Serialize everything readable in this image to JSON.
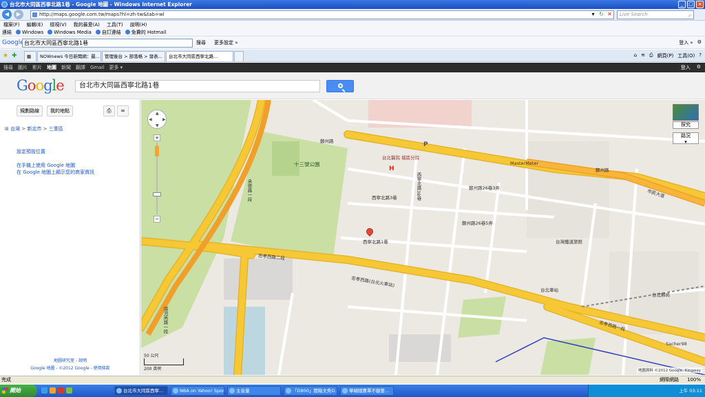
{
  "browser": {
    "title": "台北市大同區西寧北路1巷 - Google 地圖 - Windows Internet Explorer",
    "address": "http://maps.google.com.tw/maps?hl=zh-tw&tab=wl",
    "live_search": "Live Search",
    "menu": [
      "檔案(F)",
      "編輯(E)",
      "檢視(V)",
      "我的最愛(A)",
      "工具(T)",
      "說明(H)"
    ],
    "links": [
      "連結",
      "Windows",
      "Windows Media",
      "自訂連結",
      "免費的 Hotmail"
    ],
    "gtoolbar_label": "Google",
    "gtoolbar_query": "台北市大同區西寧北路1巷",
    "gtoolbar_search": "搜尋",
    "gtoolbar_more": "更多設定 »",
    "gtoolbar_login": "登入 »",
    "tabs": [
      "NOWnews 今日新聞網：最...",
      "管理後台 > 部落格 > 發表...",
      "台北市大同區西寧北路..."
    ],
    "cmd": [
      "網頁(P)",
      "工具(O)"
    ]
  },
  "gbar": {
    "items": [
      "搜尋",
      "圖片",
      "影片",
      "地圖",
      "新聞",
      "翻譯",
      "Gmail",
      "更多 ▾"
    ],
    "login": "登入"
  },
  "search": {
    "logo": "Google",
    "query": "台北市大同區西寧北路1巷"
  },
  "panel": {
    "directions": "規劃路線",
    "my_places": "我的地點",
    "breadcrumb": [
      "台灣",
      "新北市",
      "三重區"
    ],
    "set_default": "設定預設位置",
    "mobile": "在手機上使用 Google 地圖",
    "report": "在 Google 地圖上顯示您的商家資訊",
    "footer_help": "地圖研究室 - 說明",
    "footer_copy": "Google 地圖 - ©2012 Google - 使用條款"
  },
  "map": {
    "labels": {
      "park": "十三號公園",
      "hospital": "台北醫院\n城區分院",
      "zhengzhou1": "鄭州路",
      "zhengzhou2": "鄭州路",
      "civic": "市民大道",
      "zhongxiao1": "忠孝西路二段",
      "zhongxiao2": "忠孝西路(台北火車站)",
      "zhongxiao3": "忠孝西路一段",
      "xining": "西寧北路1巷",
      "xining3": "西寧北路3巷",
      "lane38": "西寧北路38巷",
      "zhengzhou26_3": "鄭州路26巷3弄",
      "zhengzhou26_5": "鄭州路26巷5弄",
      "chengde": "承德路一段",
      "huaining": "環河南路一段",
      "taipei_station": "台北車站",
      "inn": "台灣鐵道旅館",
      "post": "台北郵局",
      "sacher": "Sacher98",
      "mastermeter": "MasterMeter",
      "p": "P"
    },
    "maptype": "探究",
    "traffic": "路況",
    "scale_top": "50 公尺",
    "scale_bottom": "200 英呎",
    "logo": "Google",
    "copyright": "地圖資料 ©2012 Google, Kingway"
  },
  "status": {
    "left": "完成",
    "zone": "網際網路",
    "zoom": "100%"
  },
  "taskbar": {
    "start": "開始",
    "buttons": [
      "台北市大同區西寧...",
      "NBA on Yahoo! Sport...",
      "主音量",
      "「D800」開箱文秀D...",
      "華碩隨賣單不額筆..."
    ],
    "clock": "上午 03:11"
  },
  "colors": {
    "road_major": "#f7c836",
    "road_border": "#e5b42a",
    "park": "#c9dfa3",
    "block": "#e9e6df"
  }
}
